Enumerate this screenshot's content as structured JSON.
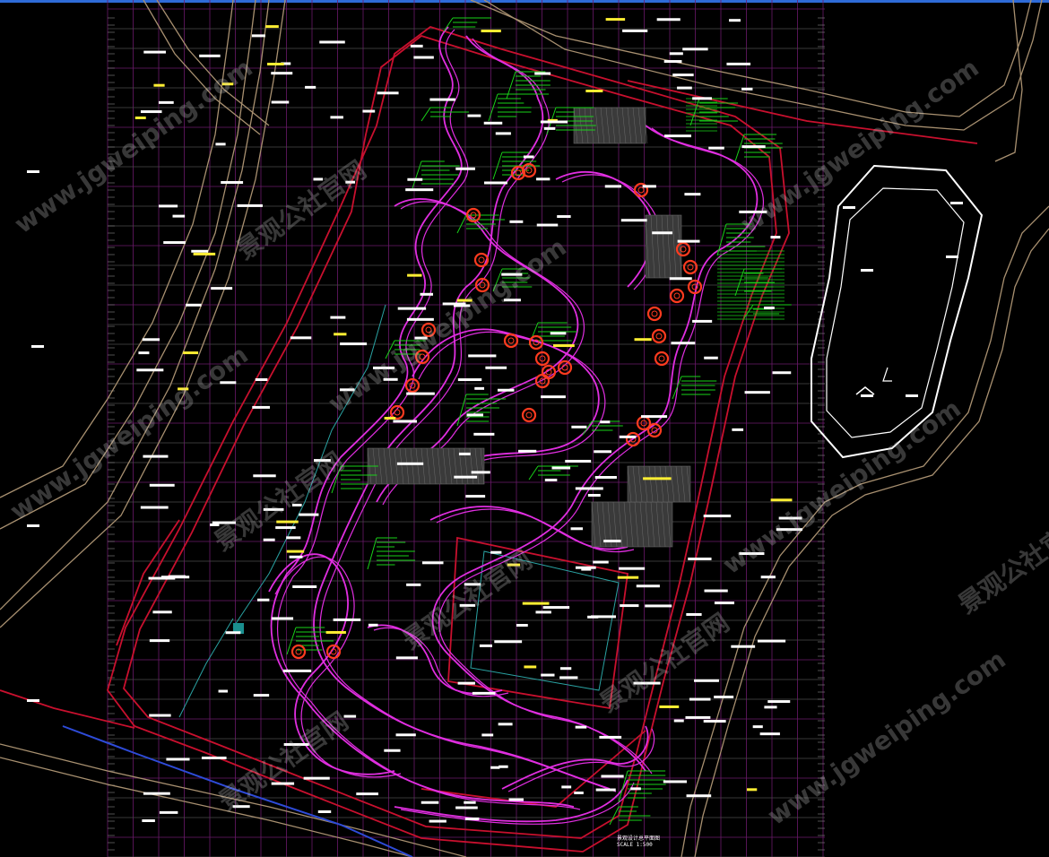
{
  "drawing": {
    "background": "#000000",
    "colors": {
      "magenta": "#e02ee0",
      "red": "#c8102e",
      "green": "#19d219",
      "grid_magenta": "#6b1a6b",
      "grid_gray": "#4a4a4a",
      "road_tan": "#a89070",
      "label_white": "#ffffff",
      "label_yellow": "#ffee33",
      "cyan": "#2aa3a3",
      "blue": "#2e4bd8",
      "tree_red": "#ff3b1f"
    },
    "title_block": [
      "景观设计总平面图",
      "SCALE 1:500"
    ]
  },
  "watermarks": [
    "www.jgweiping.com",
    "景观公社官网",
    "www.jgweiping.com",
    "景观公社官网",
    "www.jgweiping.com",
    "景观公社官网",
    "www.jgweiping.com",
    "景观公社官网",
    "www.jgweiping.com",
    "景观公社官网",
    "www.jgweiping.com",
    "景观公社官网"
  ]
}
